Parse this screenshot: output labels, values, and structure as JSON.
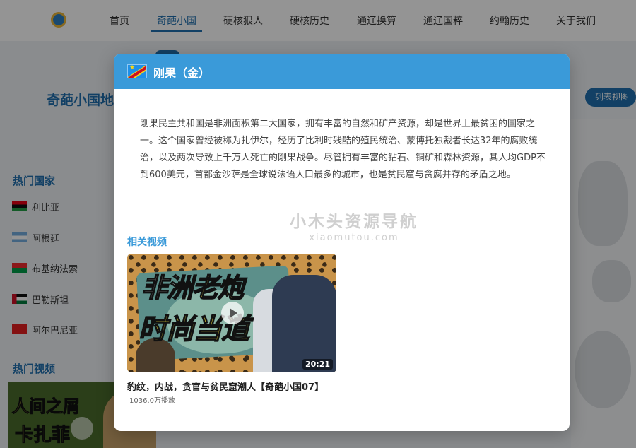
{
  "nav": {
    "items": [
      {
        "label": "首页",
        "active": false
      },
      {
        "label": "奇葩小国",
        "active": true
      },
      {
        "label": "硬核狠人",
        "active": false
      },
      {
        "label": "硬核历史",
        "active": false
      },
      {
        "label": "通辽换算",
        "active": false
      },
      {
        "label": "通辽国粹",
        "active": false
      },
      {
        "label": "约翰历史",
        "active": false
      },
      {
        "label": "关于我们",
        "active": false
      }
    ]
  },
  "background": {
    "page_title": "奇葩小国地",
    "list_view_button": "列表视图",
    "hot_countries_heading": "热门国家",
    "hot_countries": [
      {
        "name": "利比亚",
        "flag_icon": "libya-flag-icon"
      },
      {
        "name": "阿根廷",
        "flag_icon": "argentina-flag-icon"
      },
      {
        "name": "布基纳法索",
        "flag_icon": "burkina-faso-flag-icon"
      },
      {
        "name": "巴勒斯坦",
        "flag_icon": "palestine-flag-icon"
      },
      {
        "name": "阿尔巴尼亚",
        "flag_icon": "albania-flag-icon"
      }
    ],
    "hot_videos_heading": "热门视频",
    "hot_video_thumb_text": [
      "人间之屑",
      "卡扎菲"
    ]
  },
  "modal": {
    "title": "刚果（金）",
    "flag_icon": "dr-congo-flag-icon",
    "description": "刚果民主共和国是非洲面积第二大国家，拥有丰富的自然和矿产资源，却是世界上最贫困的国家之一。这个国家曾经被称为扎伊尔，经历了比利时残酷的殖民统治、蒙博托独裁者长达32年的腐败统治，以及两次导致上千万人死亡的刚果战争。尽管拥有丰富的钻石、铜矿和森林资源，其人均GDP不到600美元，首都金沙萨是全球说法语人口最多的城市，也是贫民窟与贪腐并存的矛盾之地。",
    "related_videos_heading": "相关视频",
    "videos": [
      {
        "thumb_line1_white": "非洲",
        "thumb_line1_yellow": "老炮",
        "thumb_line2": "时尚当道",
        "duration": "20:21",
        "title": "豹纹，内战，贪官与贫民窟潮人【奇葩小国07】",
        "views": "1036.0万播放"
      }
    ]
  },
  "watermark": {
    "cn": "小木头资源导航",
    "en": "xiaomutou.com"
  },
  "colors": {
    "brand_blue": "#1f6fae",
    "modal_header": "#3a9ad9",
    "accent_yellow": "#f6e23a"
  }
}
